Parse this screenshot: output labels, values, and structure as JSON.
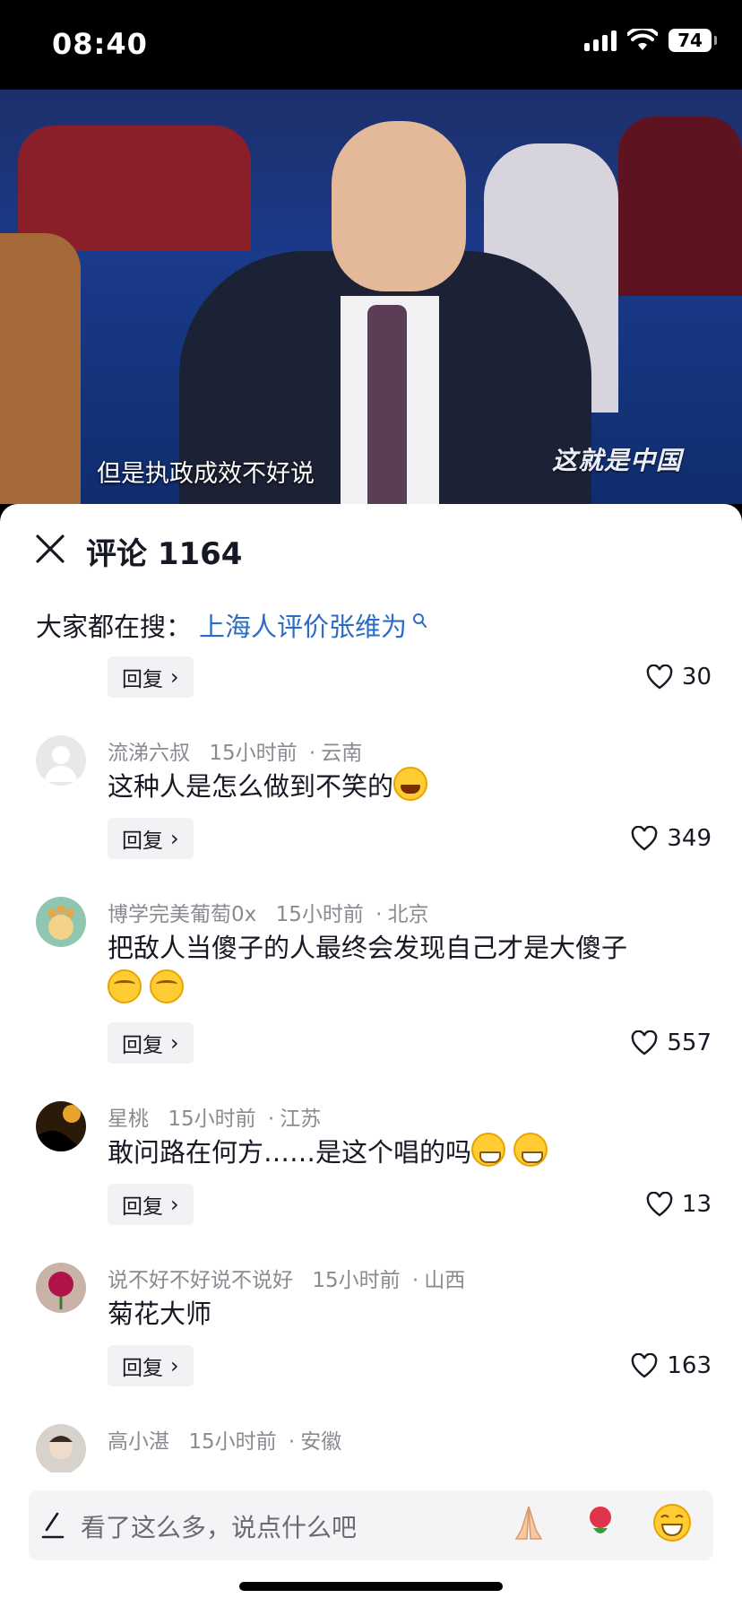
{
  "status_bar": {
    "time": "08:40",
    "battery": "74"
  },
  "video": {
    "subtitle": "但是执政成效不好说",
    "logo": "这就是中国"
  },
  "comments_panel": {
    "title": "评论 1164",
    "search_hint": {
      "label": "大家都在搜：",
      "term": "上海人评价张维为"
    },
    "partial_top": {
      "reply_label": "回复",
      "likes": "30"
    },
    "items": [
      {
        "user": "流涕六叔",
        "time": "15小时前",
        "location": "云南",
        "text": "这种人是怎么做到不笑的",
        "reply_label": "回复",
        "likes": "349"
      },
      {
        "user": "博学完美葡萄0x",
        "time": "15小时前",
        "location": "北京",
        "text": "把敌人当傻子的人最终会发现自己才是大傻子",
        "reply_label": "回复",
        "likes": "557"
      },
      {
        "user": "星桃",
        "time": "15小时前",
        "location": "江苏",
        "text": "敢问路在何方……是这个唱的吗",
        "reply_label": "回复",
        "likes": "13"
      },
      {
        "user": "说不好不好说不说好",
        "time": "15小时前",
        "location": "山西",
        "text": "菊花大师",
        "reply_label": "回复",
        "likes": "163"
      },
      {
        "user": "高小湛",
        "time": "15小时前",
        "location": "安徽"
      }
    ]
  },
  "input_bar": {
    "placeholder": "看了这么多，说点什么吧",
    "quick_emojis": [
      "folded-hands",
      "rose",
      "grin"
    ]
  },
  "colors": {
    "link": "#2b6cc4",
    "meta": "#8a8b91",
    "text": "#161823"
  }
}
